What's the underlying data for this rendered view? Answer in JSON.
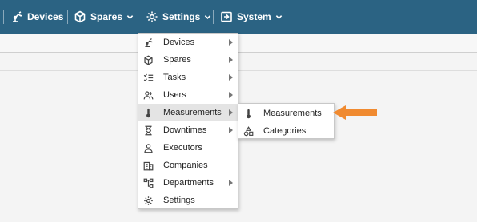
{
  "nav": {
    "items": [
      {
        "label": "Devices",
        "icon": "robot-arm-icon",
        "has_dropdown": false
      },
      {
        "label": "Spares",
        "icon": "cube-icon",
        "has_dropdown": true
      },
      {
        "label": "Settings",
        "icon": "gear-icon",
        "has_dropdown": true
      },
      {
        "label": "System",
        "icon": "system-login-icon",
        "has_dropdown": true
      }
    ]
  },
  "settings_menu": {
    "items": [
      {
        "label": "Devices",
        "icon": "robot-arm-icon",
        "has_submenu": true
      },
      {
        "label": "Spares",
        "icon": "cube-icon",
        "has_submenu": true
      },
      {
        "label": "Tasks",
        "icon": "checklist-icon",
        "has_submenu": true
      },
      {
        "label": "Users",
        "icon": "users-icon",
        "has_submenu": true
      },
      {
        "label": "Measurements",
        "icon": "thermometer-icon",
        "has_submenu": true,
        "active": true
      },
      {
        "label": "Downtimes",
        "icon": "hourglass-icon",
        "has_submenu": true
      },
      {
        "label": "Executors",
        "icon": "user-icon",
        "has_submenu": false
      },
      {
        "label": "Companies",
        "icon": "building-icon",
        "has_submenu": false
      },
      {
        "label": "Departments",
        "icon": "org-chart-icon",
        "has_submenu": true
      },
      {
        "label": "Settings",
        "icon": "gear-icon",
        "has_submenu": false
      }
    ]
  },
  "measurements_submenu": {
    "items": [
      {
        "label": "Measurements",
        "icon": "thermometer-icon"
      },
      {
        "label": "Categories",
        "icon": "shapes-icon"
      }
    ]
  },
  "colors": {
    "topbar": "#2b6383",
    "active_item": "#e4e4e4",
    "annotation_arrow": "#f08a30"
  }
}
